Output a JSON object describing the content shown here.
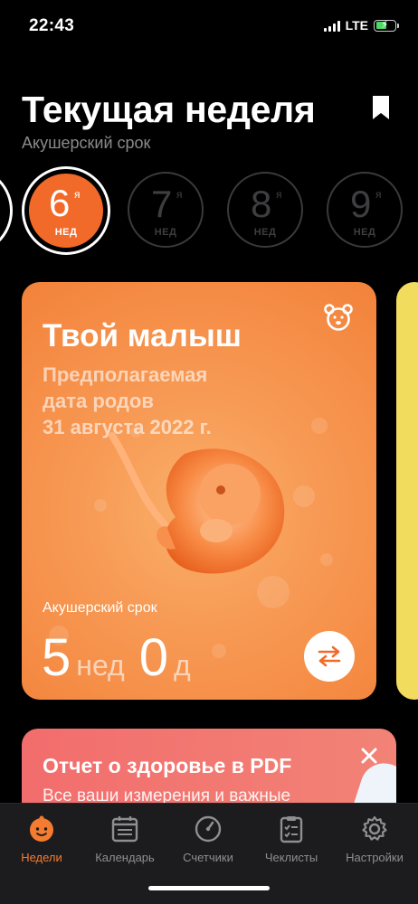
{
  "status_bar": {
    "time": "22:43",
    "network": "LTE",
    "battery_color": "#4cd964"
  },
  "header": {
    "title": "Текущая неделя",
    "subtitle": "Акушерский срок"
  },
  "weeks": {
    "unit_suffix": "я",
    "unit_label": "НЕД",
    "items": [
      {
        "number": "6",
        "active": true
      },
      {
        "number": "7",
        "active": false
      },
      {
        "number": "8",
        "active": false
      },
      {
        "number": "9",
        "active": false
      }
    ]
  },
  "baby_card": {
    "title": "Твой малыш",
    "due_line1": "Предполагаемая",
    "due_line2": "дата родов",
    "due_line3": "31 августа 2022 г.",
    "term_label": "Акушерский срок",
    "weeks_value": "5",
    "weeks_unit": "нед",
    "days_value": "0",
    "days_unit": "д",
    "icon": "bear-icon",
    "accent_color": "#f26a2a"
  },
  "promo_card": {
    "title": "Отчет о здоровье в PDF",
    "text": "Все ваши измерения и важные"
  },
  "tabbar": {
    "items": [
      {
        "label": "Недели",
        "icon": "baby-face-icon",
        "active": true
      },
      {
        "label": "Календарь",
        "icon": "calendar-icon",
        "active": false
      },
      {
        "label": "Счетчики",
        "icon": "gauge-icon",
        "active": false
      },
      {
        "label": "Чеклисты",
        "icon": "checklist-icon",
        "active": false
      },
      {
        "label": "Настройки",
        "icon": "gear-icon",
        "active": false
      }
    ],
    "active_color": "#f47b30"
  }
}
